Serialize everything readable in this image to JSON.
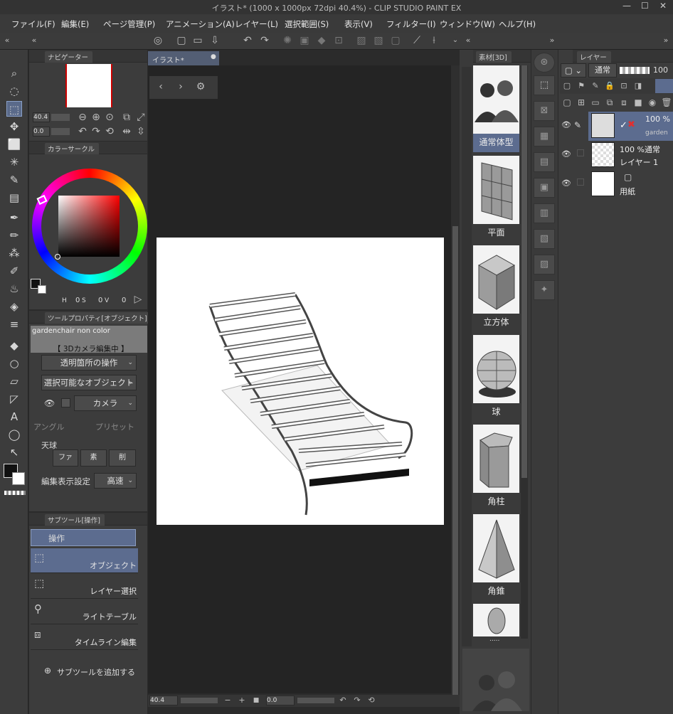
{
  "window": {
    "title": "イラスト* (1000 x 1000px 72dpi 40.4%) - CLIP STUDIO PAINT EX",
    "minimize": "—",
    "maximize": "☐",
    "close": "✕"
  },
  "menu": [
    "ファイル(F)",
    "編集(E)",
    "ページ管理(P)",
    "アニメーション(A)",
    "レイヤー(L)",
    "選択範囲(S)",
    "表示(V)",
    "フィルター(I)",
    "ウィンドウ(W)",
    "ヘルプ(H)"
  ],
  "navigator": {
    "tab": "ナビゲーター",
    "zoom": "40.4",
    "rotation": "0.0"
  },
  "color_circle": {
    "tab": "カラーサークル",
    "h_label": "H",
    "h_value": "0",
    "s_label": "S",
    "s_value": "0",
    "v_label": "V",
    "v_value": "0"
  },
  "tool_property": {
    "tab": "ツールプロパティ[オブジェクト]",
    "object_name": "gardenchair non color",
    "mode_label": "【 3Dカメラ編集中 】",
    "transparent_op": "透明箇所の操作",
    "selectable_object": "選択可能なオブジェクト",
    "camera": "カメラ",
    "angle": "アングル",
    "preset": "プリセット",
    "celestial": "天球",
    "btn_file": "ファ",
    "btn_material": "素",
    "btn_delete": "削",
    "display_setting_label": "編集表示設定",
    "display_setting_value": "高速"
  },
  "subtool": {
    "tab": "サブツール[操作]",
    "group": "操作",
    "items": [
      "オブジェクト",
      "レイヤー選択",
      "ライトテーブル",
      "タイムライン編集"
    ],
    "add_label": "サブツールを追加する"
  },
  "canvas": {
    "tab": "イラスト*",
    "zoom": "40.4",
    "rotation": "0.0"
  },
  "materials": {
    "tab": "素材[3D]",
    "items": [
      "通常体型",
      "平面",
      "立方体",
      "球",
      "角柱",
      "角錐"
    ],
    "more": "....."
  },
  "layers": {
    "tab": "レイヤー",
    "blend_mode": "通常",
    "opacity": "100",
    "list": [
      {
        "opacity_mode": "100 %",
        "name": "garden",
        "type": "3d"
      },
      {
        "opacity_mode": "100 %通常",
        "name": "レイヤー 1",
        "type": "raster"
      },
      {
        "opacity_mode": "",
        "name": "用紙",
        "type": "paper"
      }
    ]
  },
  "colors": {
    "accent": "#5c6c8f",
    "panel": "#3c3c3c",
    "background": "#242424"
  }
}
